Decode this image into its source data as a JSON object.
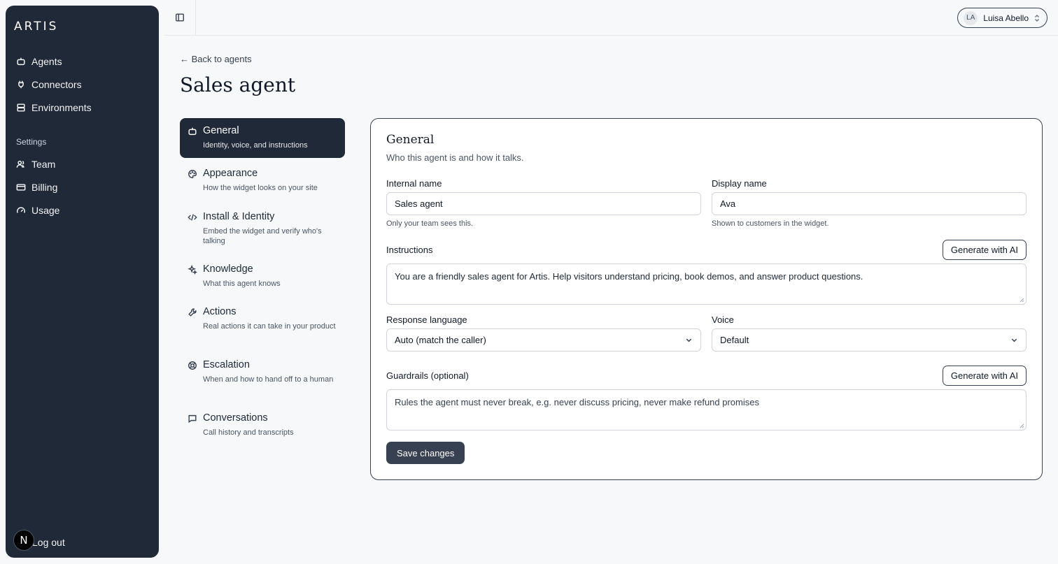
{
  "app": {
    "logo": "ARTIS",
    "n_badge": "N"
  },
  "sidebar": {
    "items": [
      {
        "label": "Agents",
        "icon": "robot-icon"
      },
      {
        "label": "Connectors",
        "icon": "plug-icon"
      },
      {
        "label": "Environments",
        "icon": "server-icon"
      }
    ],
    "settings_heading": "Settings",
    "settings_items": [
      {
        "label": "Team",
        "icon": "users-icon"
      },
      {
        "label": "Billing",
        "icon": "credit-card-icon"
      },
      {
        "label": "Usage",
        "icon": "gauge-icon"
      }
    ],
    "logout": "Log out"
  },
  "topbar": {
    "user_initials": "LA",
    "user_name": "Luisa Abello"
  },
  "header": {
    "back_link": "← Back to agents",
    "title": "Sales agent"
  },
  "sections": [
    {
      "title": "General",
      "subtitle": "Identity, voice, and instructions",
      "icon": "robot-icon",
      "active": true
    },
    {
      "title": "Appearance",
      "subtitle": "How the widget looks on your site",
      "icon": "palette-icon",
      "active": false
    },
    {
      "title": "Install & Identity",
      "subtitle": "Embed the widget and verify who's talking",
      "icon": "code-icon",
      "active": false
    },
    {
      "title": "Knowledge",
      "subtitle": "What this agent knows",
      "icon": "sparkles-icon",
      "active": false
    },
    {
      "title": "Actions",
      "subtitle": "Real actions it can take in your product",
      "icon": "wrench-icon",
      "active": false
    },
    {
      "title": "Escalation",
      "subtitle": "When and how to hand off to a human",
      "icon": "lifebuoy-icon",
      "active": false
    },
    {
      "title": "Conversations",
      "subtitle": "Call history and transcripts",
      "icon": "message-icon",
      "active": false
    }
  ],
  "form": {
    "title": "General",
    "subtitle": "Who this agent is and how it talks.",
    "internal_name": {
      "label": "Internal name",
      "value": "Sales agent",
      "hint": "Only your team sees this."
    },
    "display_name": {
      "label": "Display name",
      "value": "Ava",
      "hint": "Shown to customers in the widget."
    },
    "instructions": {
      "label": "Instructions",
      "value": "You are a friendly sales agent for Artis. Help visitors understand pricing, book demos, and answer product questions.",
      "generate_label": "Generate with AI"
    },
    "response_language": {
      "label": "Response language",
      "value": "Auto (match the caller)"
    },
    "voice": {
      "label": "Voice",
      "value": "Default"
    },
    "guardrails": {
      "label": "Guardrails (optional)",
      "placeholder": "Rules the agent must never break, e.g. never discuss pricing, never make refund promises",
      "generate_label": "Generate with AI"
    },
    "save_label": "Save changes"
  },
  "colors": {
    "sidebar_bg": "#1f2937",
    "page_bg": "#f7f8fa",
    "button_dark": "#374151"
  }
}
